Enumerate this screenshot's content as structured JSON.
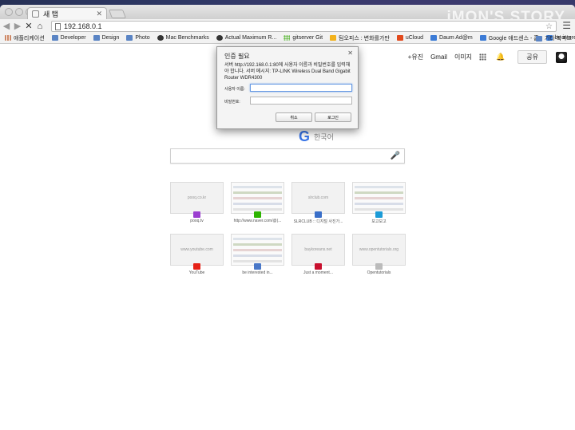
{
  "tab": {
    "title": "새 탭"
  },
  "watermark": "iMON'S STORY",
  "address": {
    "url": "192.168.0.1"
  },
  "bookmarks": [
    {
      "label": "애플리케이션",
      "icon": "grid"
    },
    {
      "label": "Developer",
      "icon": "folder"
    },
    {
      "label": "Design",
      "icon": "folder"
    },
    {
      "label": "Photo",
      "icon": "folder"
    },
    {
      "label": "Mac Benchmarks",
      "icon": "circle"
    },
    {
      "label": "Actual Maximum R...",
      "icon": "circle"
    },
    {
      "label": "gitserver Git",
      "icon": "dots"
    },
    {
      "label": "팀오피스 : 변화를가만",
      "icon": "yellow"
    },
    {
      "label": "uCloud",
      "icon": "red"
    },
    {
      "label": "Daum Ad@m",
      "icon": "blue"
    },
    {
      "label": "Google 애드센스 - 홈",
      "icon": "blue"
    },
    {
      "label": "be interested in...",
      "icon": "blue"
    }
  ],
  "bookmarks_other": "기타 북마크",
  "topnav": {
    "plus": "+유진",
    "gmail": "Gmail",
    "images": "이미지",
    "share": "공유"
  },
  "logo": {
    "sub": "한국어"
  },
  "tiles": [
    {
      "thumb": "pooq.co.kr",
      "label": "pooq.tv",
      "fav": "#9b3fd0",
      "shot": false
    },
    {
      "thumb": "",
      "label": "http://www.naver.com/@(...",
      "fav": "#2db400",
      "shot": true
    },
    {
      "thumb": "slrclub.com",
      "label": "SLRCLUB :: 디지털 사진가...",
      "fav": "#3a6fc9",
      "shot": false
    },
    {
      "thumb": "",
      "label": "보고보고",
      "fav": "#1b9bd7",
      "shot": true
    },
    {
      "thumb": "www.youtube.com",
      "label": "YouTube",
      "fav": "#e62117",
      "shot": false
    },
    {
      "thumb": "",
      "label": "be interested in...",
      "fav": "#4a78c8",
      "shot": true
    },
    {
      "thumb": "baykoreans.net",
      "label": "Just a moment...",
      "fav": "#c8102e",
      "shot": false
    },
    {
      "thumb": "www.opentutorials.org",
      "label": "Opentutorials",
      "fav": "#bbbbbb",
      "shot": false
    }
  ],
  "dialog": {
    "title": "인증 필요",
    "message": "서버 http://192.168.0.1:80에 사용자 이름과 비밀번호를 입력해야 합니다. 서버 메시지: TP-LINK Wireless Dual Band Gigabit Router WDR4300",
    "username_label": "사용자 이름:",
    "password_label": "비밀번호:",
    "cancel": "취소",
    "login": "로그인"
  }
}
